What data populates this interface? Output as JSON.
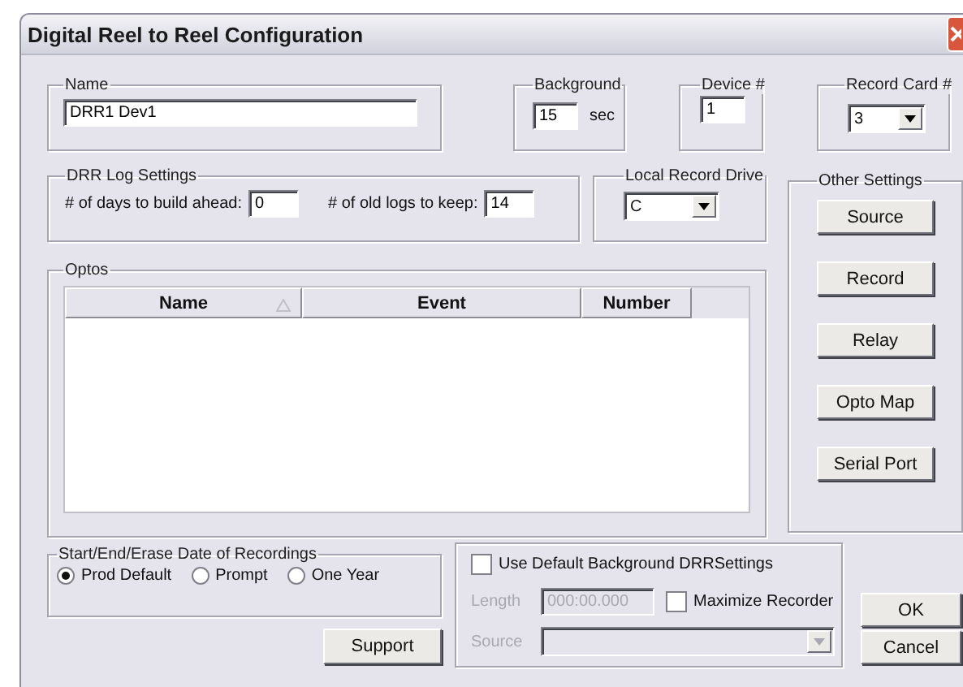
{
  "window": {
    "title": "Digital Reel to Reel Configuration"
  },
  "name_group": {
    "label": "Name",
    "value": "DRR1 Dev1"
  },
  "background": {
    "label": "Background",
    "value": "15",
    "unit": "sec"
  },
  "device": {
    "label": "Device #",
    "value": "1"
  },
  "record_card": {
    "label": "Record Card #",
    "value": "3"
  },
  "log_settings": {
    "label": "DRR Log Settings",
    "fields": [
      {
        "label": "# of days to build ahead:",
        "value": "0"
      },
      {
        "label": "# of old logs to keep:",
        "value": "14"
      }
    ]
  },
  "local_record_drive": {
    "label": "Local Record Drive",
    "value": "C"
  },
  "other_settings": {
    "label": "Other Settings",
    "buttons": [
      "Source",
      "Record",
      "Relay",
      "Opto Map",
      "Serial Port"
    ]
  },
  "optos": {
    "label": "Optos",
    "columns": [
      {
        "label": "Name",
        "sorted": true
      },
      {
        "label": "Event",
        "sorted": false
      },
      {
        "label": "Number",
        "sorted": false
      }
    ]
  },
  "recording_dates": {
    "label": "Start/End/Erase Date of Recordings",
    "options": [
      {
        "label": "Prod Default",
        "selected": true
      },
      {
        "label": "Prompt",
        "selected": false
      },
      {
        "label": "One Year",
        "selected": false
      }
    ]
  },
  "support_button": "Support",
  "default_background": {
    "label": "Use Default Background DRRSettings",
    "checked": false,
    "length": {
      "label": "Length",
      "value": "000:00.000",
      "disabled": true
    },
    "maximize": {
      "label": "Maximize Recorder",
      "checked": false
    },
    "source": {
      "label": "Source",
      "disabled": true
    }
  },
  "buttons": [
    "OK",
    "Cancel"
  ]
}
